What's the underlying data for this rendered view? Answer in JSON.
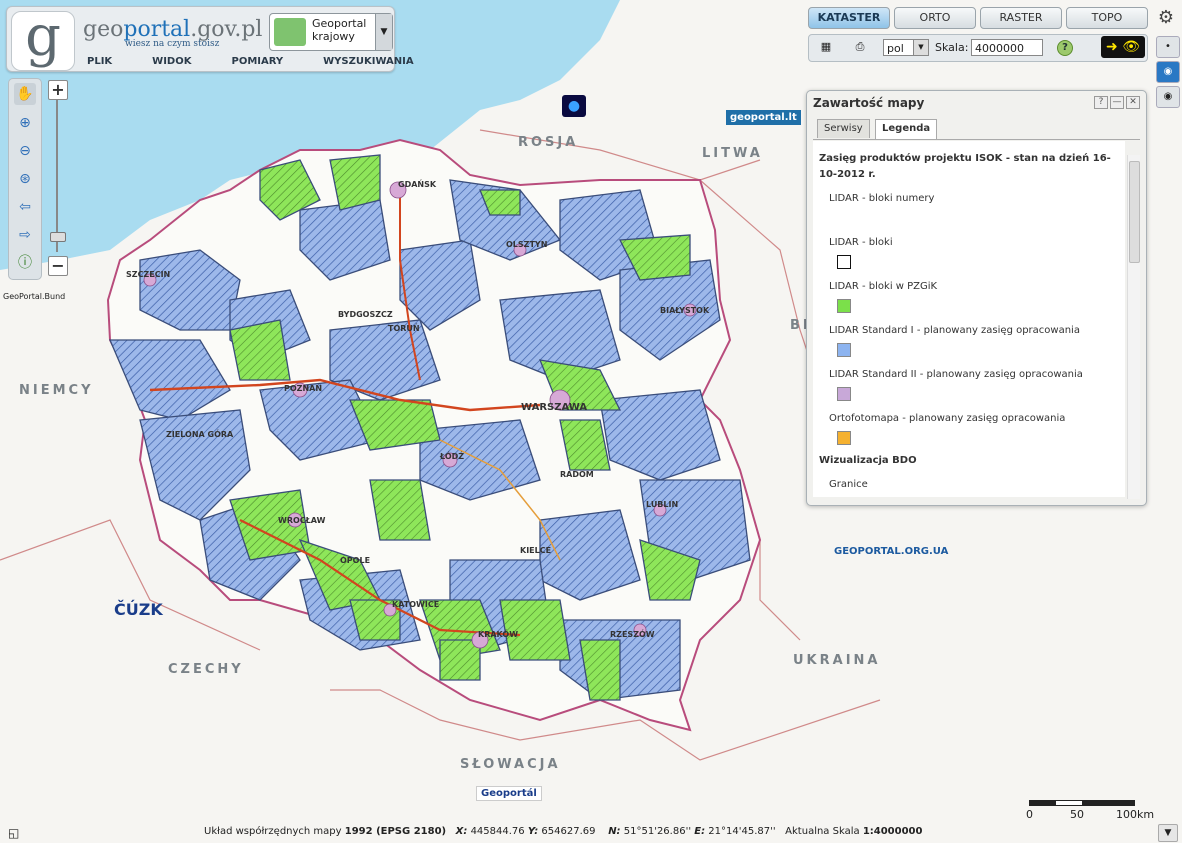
{
  "header": {
    "logo_letter": "g",
    "logo_part1": "geo",
    "logo_part2": "portal",
    "logo_part3": ".gov.pl",
    "tagline": "wiesz na czym stoisz",
    "portal_select": "Geoportal krajowy",
    "menu": [
      "PLIK",
      "WIDOK",
      "POMIARY",
      "WYSZUKIWANIA"
    ]
  },
  "map_tabs": [
    {
      "label": "KATASTER",
      "active": true
    },
    {
      "label": "ORTO",
      "active": false
    },
    {
      "label": "RASTER",
      "active": false
    },
    {
      "label": "TOPO",
      "active": false
    }
  ],
  "toolbar": {
    "lang": "pol",
    "scale_label": "Skala:",
    "scale_value": "4000000",
    "help": "?"
  },
  "panel": {
    "title": "Zawartość mapy",
    "tabs": [
      "Serwisy",
      "Legenda"
    ],
    "active_tab": "Legenda",
    "legend_heading": "Zasięg produktów projektu ISOK - stan na dzień 16-10-2012 r.",
    "items": [
      {
        "label": "LIDAR - bloki numery",
        "color": "#ffffff"
      },
      {
        "label": "LIDAR - bloki",
        "color": "#ffffff"
      },
      {
        "label": "LIDAR - bloki w PZGiK",
        "color": "#7be04a"
      },
      {
        "label": "LIDAR Standard I - planowany zasięg opracowania",
        "color": "#8db4f0"
      },
      {
        "label": "LIDAR Standard II - planowany zasięg opracowania",
        "color": "#c8a8d8"
      },
      {
        "label": "Ortofotomapa - planowany zasięg opracowania",
        "color": "#f5b130"
      }
    ],
    "section2": "Wizualizacja BDO",
    "section2_item": "Granice"
  },
  "map_labels": {
    "countries": [
      "ROSJA",
      "LITWA",
      "BIAŁORUŚ",
      "NIEMCY",
      "CZECHY",
      "UKRAINA",
      "SŁOWACJA"
    ],
    "cities": [
      "GDAŃSK",
      "OLSZTYN",
      "SZCZECIN",
      "BYDGOSZCZ",
      "TORUŃ",
      "POZNAŃ",
      "WARSZAWA",
      "ŁÓDŹ",
      "WROCŁAW",
      "KRAKÓW",
      "LUBLIN",
      "RZESZÓW",
      "KIELCE",
      "KATOWICE",
      "BIAŁYSTOK",
      "ZIELONA GÓRA",
      "OPOLE",
      "RADOM"
    ],
    "partner_logos": [
      "geoportal.lt",
      "GeoPortal.Bund",
      "ČÚZK",
      "GEOPORTAL.ORG.UA",
      "Geoportál"
    ]
  },
  "statusbar": {
    "coord_label": "Układ współrzędnych mapy",
    "coord_system": "1992 (EPSG 2180)",
    "x_label": "X:",
    "x": "445844.76",
    "y_label": "Y:",
    "y": "654627.69",
    "n_label": "N:",
    "n": "51°51'26.86''",
    "e_label": "E:",
    "e": "21°14'45.87''",
    "scale_label": "Aktualna Skala",
    "scale": "1:4000000"
  },
  "scalebar": {
    "ticks": [
      "0",
      "50",
      "100km"
    ]
  },
  "colors": {
    "sea": "#a9dcf0",
    "lidar_green": "#7be04a",
    "lidar_blue": "#8db4f0",
    "accent": "#2a78c4"
  }
}
